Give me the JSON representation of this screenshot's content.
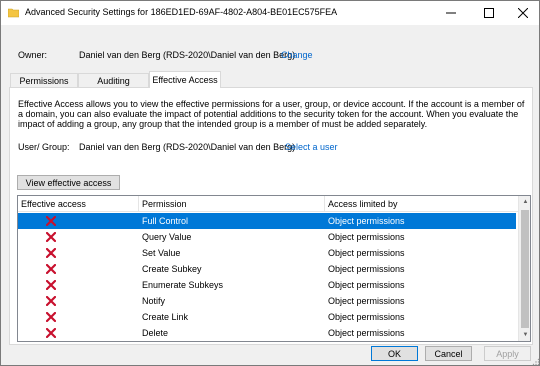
{
  "window": {
    "title": "Advanced Security Settings for 186ED1ED-69AF-4802-A804-BE01EC575FEA"
  },
  "owner": {
    "label": "Owner:",
    "value": "Daniel van den Berg (RDS-2020\\Daniel van den Berg)",
    "change_link": "Change"
  },
  "tabs": [
    {
      "label": "Permissions"
    },
    {
      "label": "Auditing"
    },
    {
      "label": "Effective Access",
      "active": true
    }
  ],
  "description": "Effective Access allows you to view the effective permissions for a user, group, or device account. If the account is a member of a domain, you can also evaluate the impact of potential additions to the security token for the account. When you evaluate the impact of adding a group, any group that the intended group is a member of must be added separately.",
  "user_group": {
    "label": "User/ Group:",
    "value": "Daniel van den Berg (RDS-2020\\Daniel van den Berg)",
    "select_link": "Select a user"
  },
  "view_button": "View effective access",
  "grid": {
    "columns": [
      "Effective access",
      "Permission",
      "Access limited by"
    ],
    "rows": [
      {
        "effective": "denied",
        "permission": "Full Control",
        "limited_by": "Object permissions",
        "selected": true
      },
      {
        "effective": "denied",
        "permission": "Query Value",
        "limited_by": "Object permissions"
      },
      {
        "effective": "denied",
        "permission": "Set Value",
        "limited_by": "Object permissions"
      },
      {
        "effective": "denied",
        "permission": "Create Subkey",
        "limited_by": "Object permissions"
      },
      {
        "effective": "denied",
        "permission": "Enumerate Subkeys",
        "limited_by": "Object permissions"
      },
      {
        "effective": "denied",
        "permission": "Notify",
        "limited_by": "Object permissions"
      },
      {
        "effective": "denied",
        "permission": "Create Link",
        "limited_by": "Object permissions"
      },
      {
        "effective": "denied",
        "permission": "Delete",
        "limited_by": "Object permissions"
      }
    ]
  },
  "buttons": {
    "ok": "OK",
    "cancel": "Cancel",
    "apply": "Apply"
  },
  "colors": {
    "selection": "#0078d7",
    "link": "#0066cc",
    "deny_icon": "#c8102e"
  },
  "icons": {
    "title": "folder-icon",
    "deny": "red-x-icon"
  }
}
